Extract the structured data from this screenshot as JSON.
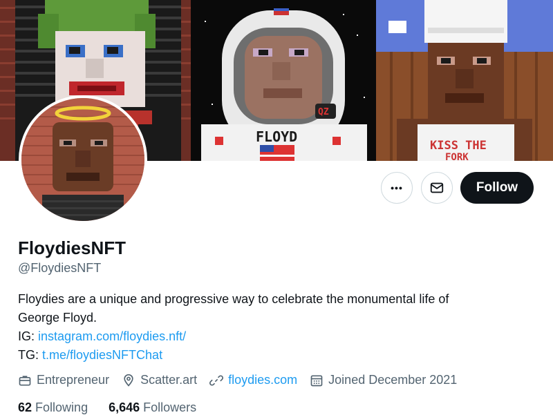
{
  "profile": {
    "name": "FloydiesNFT",
    "handle": "@FloydiesNFT",
    "bio_line1": "Floydies are a unique and progressive way to celebrate the monumental life of",
    "bio_line2": "George Floyd.",
    "ig_label": "IG:",
    "ig_link": "instagram.com/floydies.nft/",
    "tg_label": "TG:",
    "tg_link": "t.me/floydiesNFTChat"
  },
  "meta": {
    "occupation": "Entrepreneur",
    "location": "Scatter.art",
    "website": "floydies.com",
    "joined": "Joined December 2021"
  },
  "stats": {
    "following_count": "62",
    "following_label": "Following",
    "followers_count": "6,646",
    "followers_label": "Followers"
  },
  "actions": {
    "more_label": "•••",
    "follow_label": "Follow"
  },
  "banner": {
    "astronaut_text": "FLOYD",
    "patch_text": "QZ",
    "shirt_text_1": "KISS THE",
    "shirt_text_2": "FORK"
  },
  "colors": {
    "link": "#1d9bf0",
    "text": "#0f1419",
    "muted": "#536471",
    "follow_bg": "#0f1419"
  }
}
